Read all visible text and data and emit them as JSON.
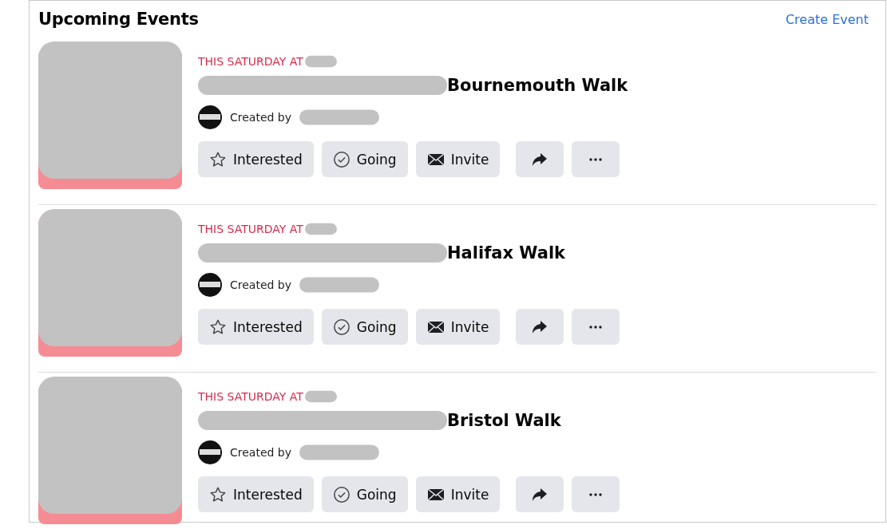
{
  "header": {
    "title": "Upcoming Events",
    "action": "Create Event"
  },
  "events": [
    {
      "date": "THIS SATURDAY AT",
      "title": "Bournemouth Walk",
      "creator_label": "Created by",
      "buttons": [
        "Interested",
        "Going",
        "Invite"
      ]
    },
    {
      "date": "THIS SATURDAY AT",
      "title": "Halifax Walk",
      "creator_label": "Created by",
      "buttons": [
        "Interested",
        "Going",
        "Invite"
      ]
    },
    {
      "date": "THIS SATURDAY AT",
      "title": "Bristol Walk",
      "creator_label": "Created by",
      "buttons": [
        "Interested",
        "Going",
        "Invite"
      ]
    }
  ]
}
